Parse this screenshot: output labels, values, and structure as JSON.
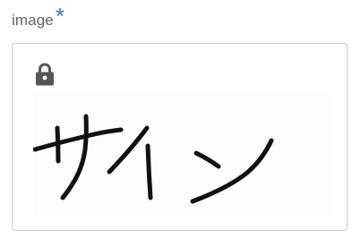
{
  "field": {
    "label": "image",
    "required_mark": "*",
    "required_color": "#4a76b5"
  },
  "image_box": {
    "locked": true,
    "lock_icon": "lock-icon",
    "content": "handwritten-signature",
    "signature_text": "サイン"
  }
}
